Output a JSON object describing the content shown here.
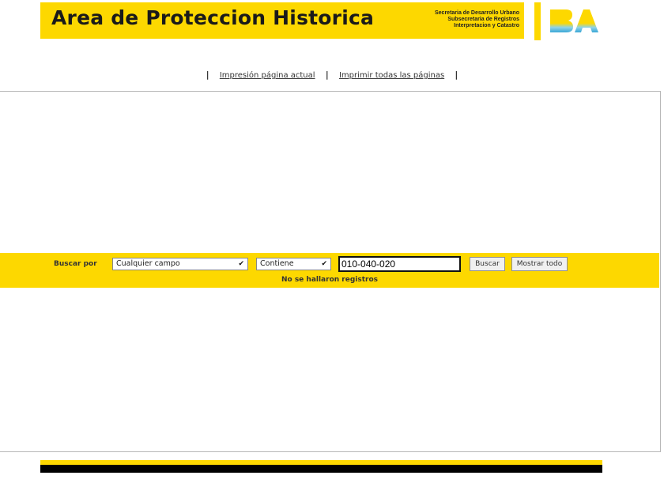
{
  "header": {
    "title": "Area de Proteccion Historica",
    "subtitle_lines": [
      "Secretaria de Desarrollo Urbano",
      "Subsecretaria de Registros",
      "Interpretacion y Catastro"
    ],
    "logo_text": "BA",
    "accent_color": "#fdd800"
  },
  "print_links": {
    "separator": "|",
    "current_page": "Impresión página actual",
    "all_pages": "Imprimir todas las páginas"
  },
  "search": {
    "label": "Buscar por",
    "field_select": {
      "selected": "Cualquier campo",
      "icon": "chevron-down-icon"
    },
    "operator_select": {
      "selected": "Contiene",
      "icon": "chevron-down-icon"
    },
    "query_value": "010-040-020",
    "search_button": "Buscar",
    "show_all_button": "Mostrar todo",
    "status_message": "No se hallaron registros"
  }
}
